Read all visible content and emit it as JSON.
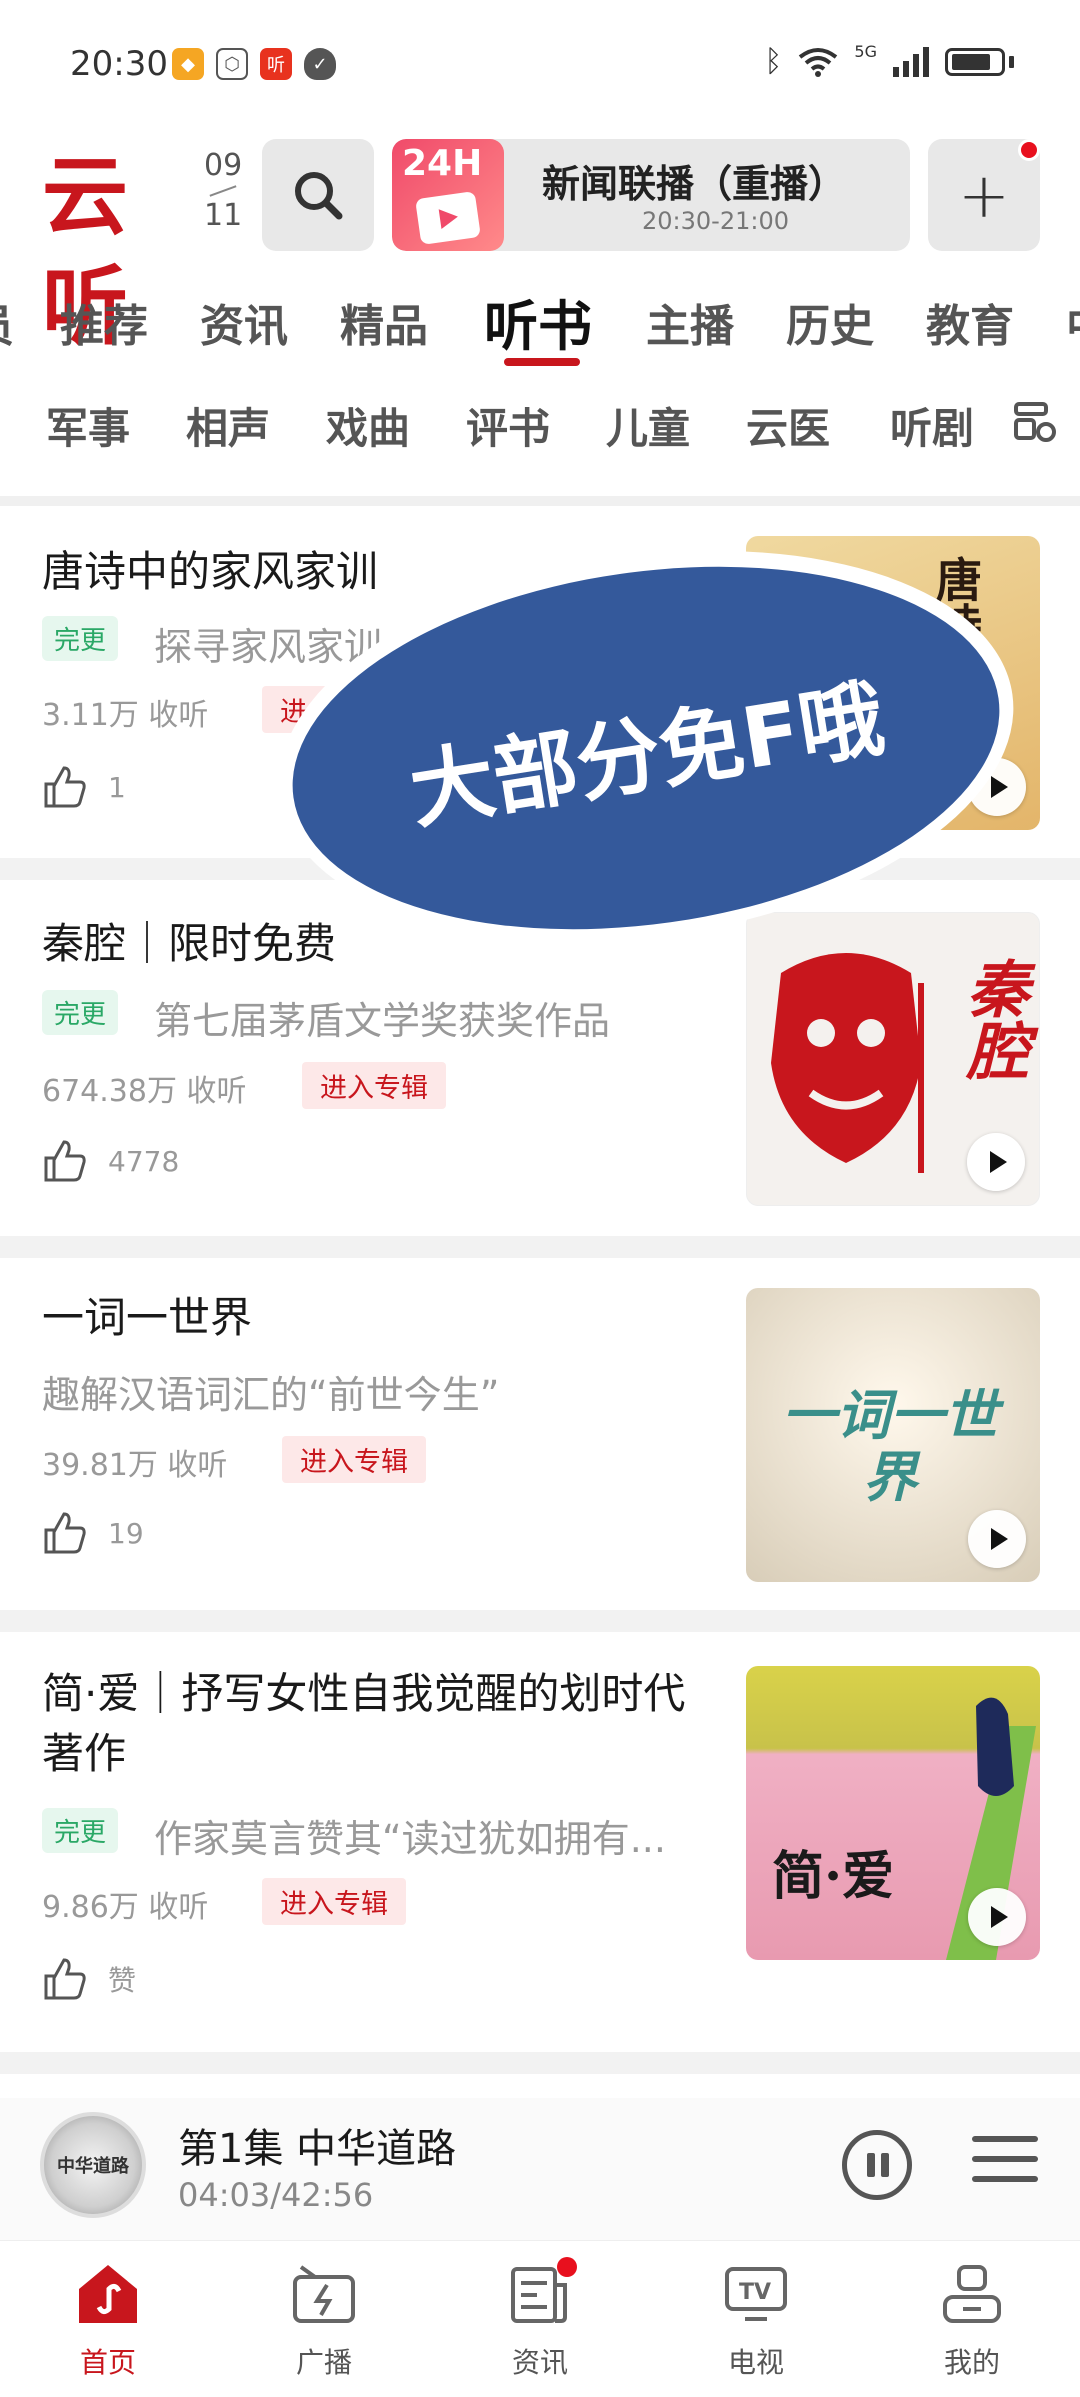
{
  "status_bar": {
    "time": "20:30",
    "network": "5G",
    "left_icons": [
      "shield-app-icon",
      "app-icon",
      "ting-app-icon",
      "security-icon"
    ],
    "right_icons": [
      "bluetooth-icon",
      "wifi-icon",
      "signal-icon",
      "battery-icon"
    ]
  },
  "header": {
    "logo_text": "云听",
    "date_month": "09",
    "date_day": "11",
    "live": {
      "badge": "24H",
      "title": "新闻联播（重播）",
      "time": "20:30-21:00"
    },
    "plus_label": "+"
  },
  "tabs": [
    "员",
    "推荐",
    "资讯",
    "精品",
    "听书",
    "主播",
    "历史",
    "教育",
    "中"
  ],
  "active_tab": "听书",
  "subtabs": [
    "军事",
    "相声",
    "戏曲",
    "评书",
    "儿童",
    "云医",
    "听剧"
  ],
  "overlay": {
    "text": "大部分免F哦"
  },
  "cards": [
    {
      "title": "唐诗中的家风家训",
      "tag": "完更",
      "subtitle": "探寻家风家训",
      "count": "3.11万 收听",
      "enter": "进入专辑",
      "likes": "1",
      "cover_text": "唐诗中的家",
      "cover_color": "#e8c98a"
    },
    {
      "title": "秦腔｜限时免费",
      "tag": "完更",
      "subtitle": "第七届茅盾文学奖获奖作品",
      "count": "674.38万 收听",
      "enter": "进入专辑",
      "likes": "4778",
      "cover_text": "秦腔",
      "cover_color": "#f4f1ee"
    },
    {
      "title": "一词一世界",
      "tag": "",
      "subtitle": "趣解汉语词汇的“前世今生”",
      "count": "39.81万 收听",
      "enter": "进入专辑",
      "likes": "19",
      "cover_text": "一词一世界",
      "cover_color": "#e9e4d6"
    },
    {
      "title": "简·爱｜抒写女性自我觉醒的划时代著作",
      "tag": "完更",
      "subtitle": "作家莫言赞其“读过犹如拥有...",
      "count": "9.86万 收听",
      "enter": "进入专辑",
      "likes": "赞",
      "cover_text": "简·爱",
      "cover_color": "#e8a8b8"
    }
  ],
  "player": {
    "title": "第1集 中华道路",
    "time": "04:03/42:56",
    "disc_text": "中华道路"
  },
  "bottom_nav": [
    {
      "label": "首页",
      "icon": "home-icon",
      "active": true
    },
    {
      "label": "广播",
      "icon": "radio-icon",
      "active": false
    },
    {
      "label": "资讯",
      "icon": "news-icon",
      "active": false,
      "dot": true
    },
    {
      "label": "电视",
      "icon": "tv-icon",
      "active": false
    },
    {
      "label": "我的",
      "icon": "profile-icon",
      "active": false
    }
  ],
  "colors": {
    "brand_red": "#c8161d",
    "overlay_blue": "#34599b",
    "tag_green": "#2aa866"
  }
}
